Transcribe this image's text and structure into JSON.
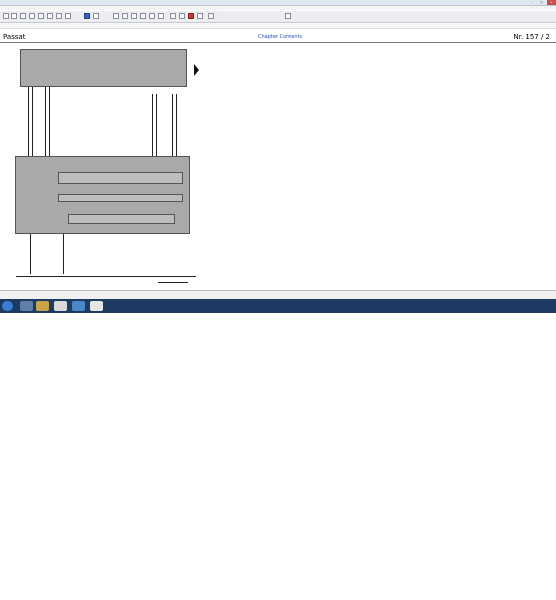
{
  "window": {
    "title": "",
    "controls": [
      "–",
      "□",
      "×"
    ]
  },
  "menubar": {
    "items": []
  },
  "header": {
    "left_title": "Passat",
    "center_link": "Chapter Contents",
    "right_page": "Nr. 157 / 2"
  },
  "legend": {
    "rows": [
      {
        "code": "",
        "desc": ""
      },
      {
        "code": "",
        "desc": ""
      },
      {
        "code": "",
        "desc": ""
      },
      {
        "code": "",
        "desc": ""
      },
      {
        "code": "",
        "desc": ""
      },
      {
        "code": "",
        "desc": ""
      },
      {
        "code": "",
        "desc": ""
      },
      {
        "code": "",
        "desc": ""
      },
      {
        "code": "",
        "desc": ""
      },
      {
        "code": "",
        "desc": ""
      },
      {
        "code": "",
        "desc": ""
      },
      {
        "code": "",
        "desc": ""
      },
      {
        "code": "",
        "desc": ""
      },
      {
        "code": "",
        "desc": ""
      },
      {
        "code": "",
        "desc": ""
      },
      {
        "code": "",
        "desc": ""
      },
      {
        "code": "",
        "desc": ""
      },
      {
        "code": "",
        "desc": ""
      },
      {
        "code": "",
        "desc": ""
      },
      {
        "code": "",
        "desc": ""
      },
      {
        "code": "",
        "desc": ""
      },
      {
        "code": "",
        "desc": ""
      },
      {
        "code": "",
        "desc": ""
      },
      {
        "code": "",
        "desc": ""
      }
    ]
  },
  "statusbar": {
    "left": "",
    "middle": "",
    "right": ""
  },
  "taskbar": {
    "clock_time": "",
    "clock_date": ""
  },
  "colors": {
    "taskbar": "#1d3b62",
    "link": "#1a4fb0",
    "legend_text": "#3e3ea0",
    "module_fill": "#a9a9a9"
  }
}
